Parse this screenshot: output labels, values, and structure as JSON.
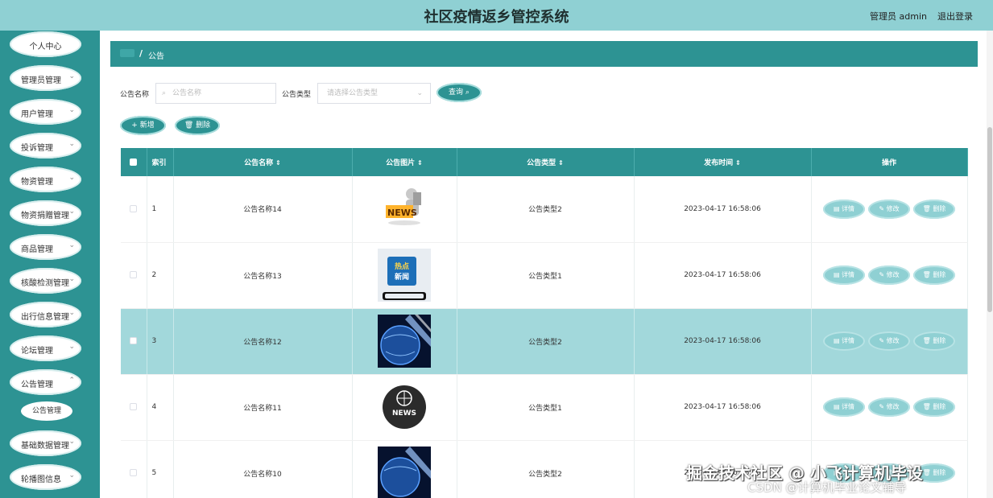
{
  "header": {
    "title": "社区疫情返乡管控系统",
    "admin": "管理员 admin",
    "logout": "退出登录"
  },
  "sidebar": {
    "items": [
      {
        "label": "个人中心",
        "expandable": false
      },
      {
        "label": "管理员管理",
        "expandable": true
      },
      {
        "label": "用户管理",
        "expandable": true
      },
      {
        "label": "投诉管理",
        "expandable": true
      },
      {
        "label": "物资管理",
        "expandable": true
      },
      {
        "label": "物资捐赠管理",
        "expandable": true
      },
      {
        "label": "商品管理",
        "expandable": true
      },
      {
        "label": "核酸检测管理",
        "expandable": true
      },
      {
        "label": "出行信息管理",
        "expandable": true
      },
      {
        "label": "论坛管理",
        "expandable": true
      },
      {
        "label": "公告管理",
        "expandable": true
      }
    ],
    "sub_item": "公告管理",
    "items_after": [
      {
        "label": "基础数据管理",
        "expandable": true
      },
      {
        "label": "轮播图信息",
        "expandable": true
      }
    ]
  },
  "breadcrumb": {
    "sep": "/",
    "current": "公告"
  },
  "search": {
    "name_label": "公告名称",
    "name_placeholder": "公告名称",
    "type_label": "公告类型",
    "type_placeholder": "请选择公告类型",
    "query_button": "查询"
  },
  "toolbar": {
    "add_label": "新增",
    "delete_label": "删除"
  },
  "table": {
    "headers": {
      "index": "索引",
      "name": "公告名称",
      "image": "公告图片",
      "type": "公告类型",
      "time": "发布时间",
      "actions": "操作"
    },
    "rows": [
      {
        "index": "1",
        "name": "公告名称14",
        "image": "news-figure",
        "type": "公告类型2",
        "time": "2023-04-17 16:58:06"
      },
      {
        "index": "2",
        "name": "公告名称13",
        "image": "hot-news-phone",
        "type": "公告类型1",
        "time": "2023-04-17 16:58:06"
      },
      {
        "index": "3",
        "name": "公告名称12",
        "image": "globe-blue",
        "type": "公告类型2",
        "time": "2023-04-17 16:58:06"
      },
      {
        "index": "4",
        "name": "公告名称11",
        "image": "news-globe-badge",
        "type": "公告类型1",
        "time": "2023-04-17 16:58:06"
      },
      {
        "index": "5",
        "name": "公告名称10",
        "image": "globe-blue",
        "type": "公告类型2",
        "time": "2023-04-17 16:58:06"
      }
    ],
    "actions": {
      "detail": "详情",
      "edit": "修改",
      "delete": "删除"
    },
    "image_text": {
      "news": "NEWS",
      "hot_news": "热点新闻",
      "news_badge": "NEWS"
    }
  },
  "watermark": {
    "line1": "掘金技术社区 @ 小飞计算机毕设",
    "line2": "CSDN @计算机毕业论文辅导"
  },
  "colors": {
    "primary": "#2d9393",
    "header": "#8fd0d3",
    "highlight_row": "#a2d8db"
  }
}
